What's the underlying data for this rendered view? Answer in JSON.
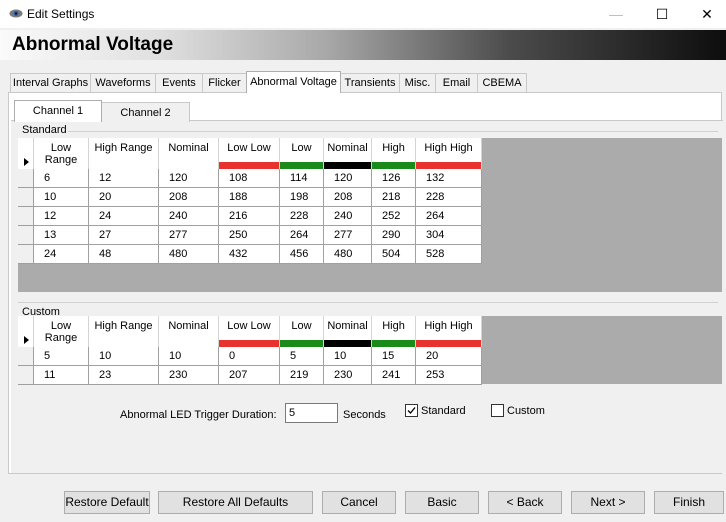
{
  "window": {
    "title": "Edit Settings",
    "icon": "eye-icon",
    "minimize_glyph": "—",
    "maximize_glyph": "☐",
    "close_glyph": "✕"
  },
  "header": {
    "title": "Abnormal Voltage"
  },
  "tabs": [
    "Interval Graphs",
    "Waveforms",
    "Events",
    "Flicker",
    "Abnormal Voltage",
    "Transients",
    "Misc.",
    "Email",
    "CBEMA"
  ],
  "active_tab": "Abnormal Voltage",
  "channel_tabs": [
    "Channel 1",
    "Channel 2"
  ],
  "active_channel_tab": "Channel 1",
  "colors": {
    "red": "#e8322d",
    "green": "#1a8a1a",
    "black": "#000000"
  },
  "standard": {
    "label": "Standard",
    "columns": [
      "Low Range",
      "High Range",
      "Nominal",
      "Low Low",
      "Low",
      "Nominal",
      "High",
      "High High"
    ],
    "rows": [
      [
        "6",
        "12",
        "120",
        "108",
        "114",
        "120",
        "126",
        "132"
      ],
      [
        "10",
        "20",
        "208",
        "188",
        "198",
        "208",
        "218",
        "228"
      ],
      [
        "12",
        "24",
        "240",
        "216",
        "228",
        "240",
        "252",
        "264"
      ],
      [
        "13",
        "27",
        "277",
        "250",
        "264",
        "277",
        "290",
        "304"
      ],
      [
        "24",
        "48",
        "480",
        "432",
        "456",
        "480",
        "504",
        "528"
      ]
    ]
  },
  "custom": {
    "label": "Custom",
    "columns": [
      "Low Range",
      "High Range",
      "Nominal",
      "Low Low",
      "Low",
      "Nominal",
      "High",
      "High High"
    ],
    "rows": [
      [
        "5",
        "10",
        "10",
        "0",
        "5",
        "10",
        "15",
        "20"
      ],
      [
        "11",
        "23",
        "230",
        "207",
        "219",
        "230",
        "241",
        "253"
      ]
    ]
  },
  "trigger": {
    "label": "Abnormal LED Trigger Duration:",
    "value": "5",
    "unit": "Seconds",
    "standard_label": "Standard",
    "standard_checked": true,
    "custom_label": "Custom",
    "custom_checked": false
  },
  "buttons": {
    "restore_default": "Restore Default",
    "restore_all": "Restore All Defaults",
    "cancel": "Cancel",
    "basic": "Basic",
    "back": "< Back",
    "next": "Next >",
    "finish": "Finish"
  }
}
